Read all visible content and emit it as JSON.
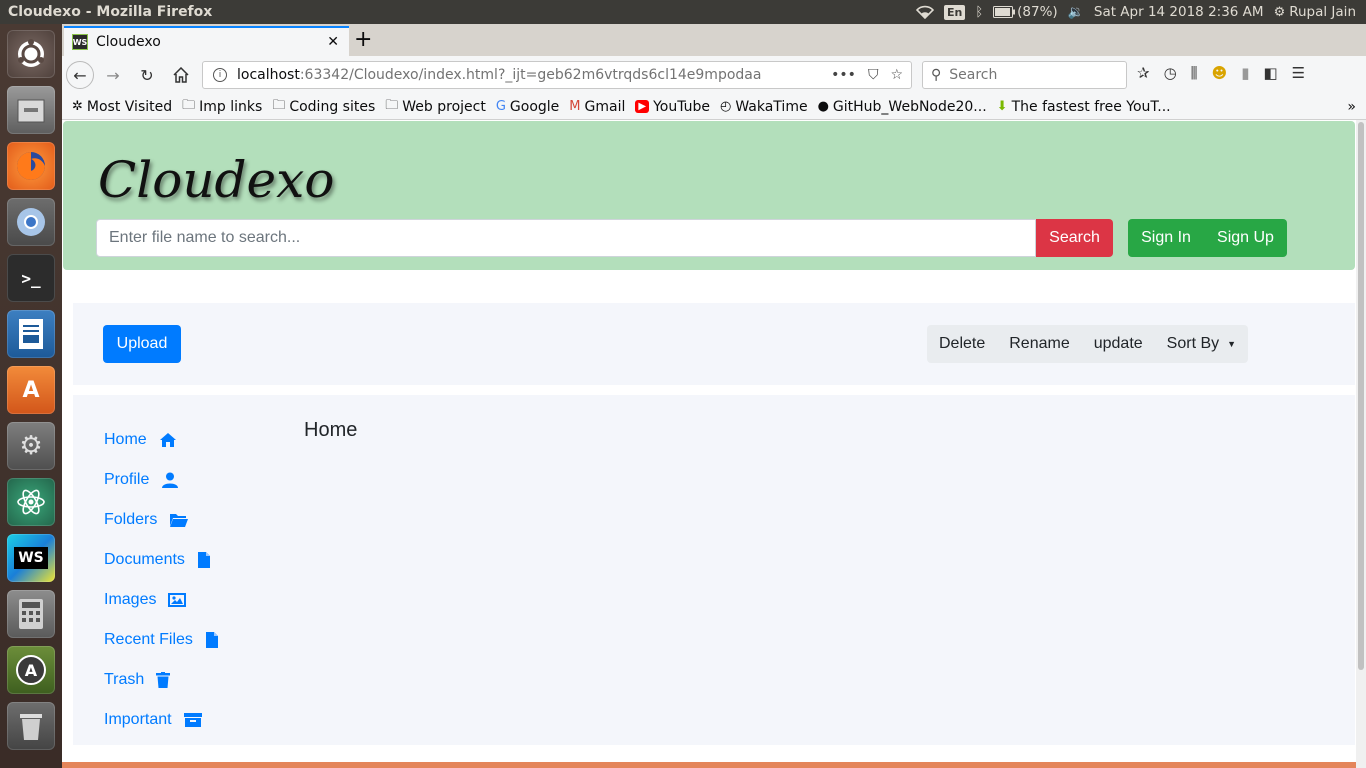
{
  "os": {
    "window_title": "Cloudexo - Mozilla Firefox",
    "keyboard": "En",
    "battery": "(87%)",
    "datetime": "Sat Apr 14 2018  2:36 AM",
    "user": "Rupal Jain"
  },
  "launcher": [
    "ubuntu-dash-icon",
    "files-icon",
    "firefox-icon",
    "chromium-icon",
    "terminal-icon",
    "writer-icon",
    "software-center-icon",
    "settings-icon",
    "atom-icon",
    "webstorm-icon",
    "calculator-icon",
    "updater-icon",
    "trash-icon"
  ],
  "browser": {
    "tab_title": "Cloudexo",
    "favicon_text": "WS",
    "url_host": "localhost",
    "url_path": ":63342/Cloudexo/index.html?_ijt=geb62m6vtrqds6cl14e9mpodaa",
    "search_placeholder": "Search",
    "bookmarks": [
      {
        "label": "Most Visited",
        "icon": "gear-icon"
      },
      {
        "label": "Imp links",
        "icon": "folder-icon"
      },
      {
        "label": "Coding sites",
        "icon": "folder-icon"
      },
      {
        "label": "Web project",
        "icon": "folder-icon"
      },
      {
        "label": "Google",
        "icon": "google-icon"
      },
      {
        "label": "Gmail",
        "icon": "gmail-icon"
      },
      {
        "label": "YouTube",
        "icon": "youtube-icon"
      },
      {
        "label": "WakaTime",
        "icon": "wakatime-icon"
      },
      {
        "label": "GitHub_WebNode20...",
        "icon": "github-icon"
      },
      {
        "label": "The fastest free YouT...",
        "icon": "download-icon"
      }
    ]
  },
  "page": {
    "brand": "Cloudexo",
    "search_placeholder": "Enter file name to search...",
    "search_button": "Search",
    "sign_in": "Sign In",
    "sign_up": "Sign Up",
    "upload": "Upload",
    "actions": {
      "delete": "Delete",
      "rename": "Rename",
      "update": "update",
      "sort_by": "Sort By"
    },
    "sidebar": [
      {
        "label": "Home",
        "icon": "home-icon"
      },
      {
        "label": "Profile",
        "icon": "user-icon"
      },
      {
        "label": "Folders",
        "icon": "folder-open-icon"
      },
      {
        "label": "Documents",
        "icon": "file-icon"
      },
      {
        "label": "Images",
        "icon": "image-icon"
      },
      {
        "label": "Recent Files",
        "icon": "file-icon"
      },
      {
        "label": "Trash",
        "icon": "trash-icon"
      },
      {
        "label": "Important",
        "icon": "archive-icon"
      }
    ],
    "content_title": "Home"
  },
  "colors": {
    "jumbotron": "#b3dfbb",
    "danger": "#dc3545",
    "success": "#28a745",
    "primary": "#007bff",
    "panel": "#f4f6fb"
  }
}
